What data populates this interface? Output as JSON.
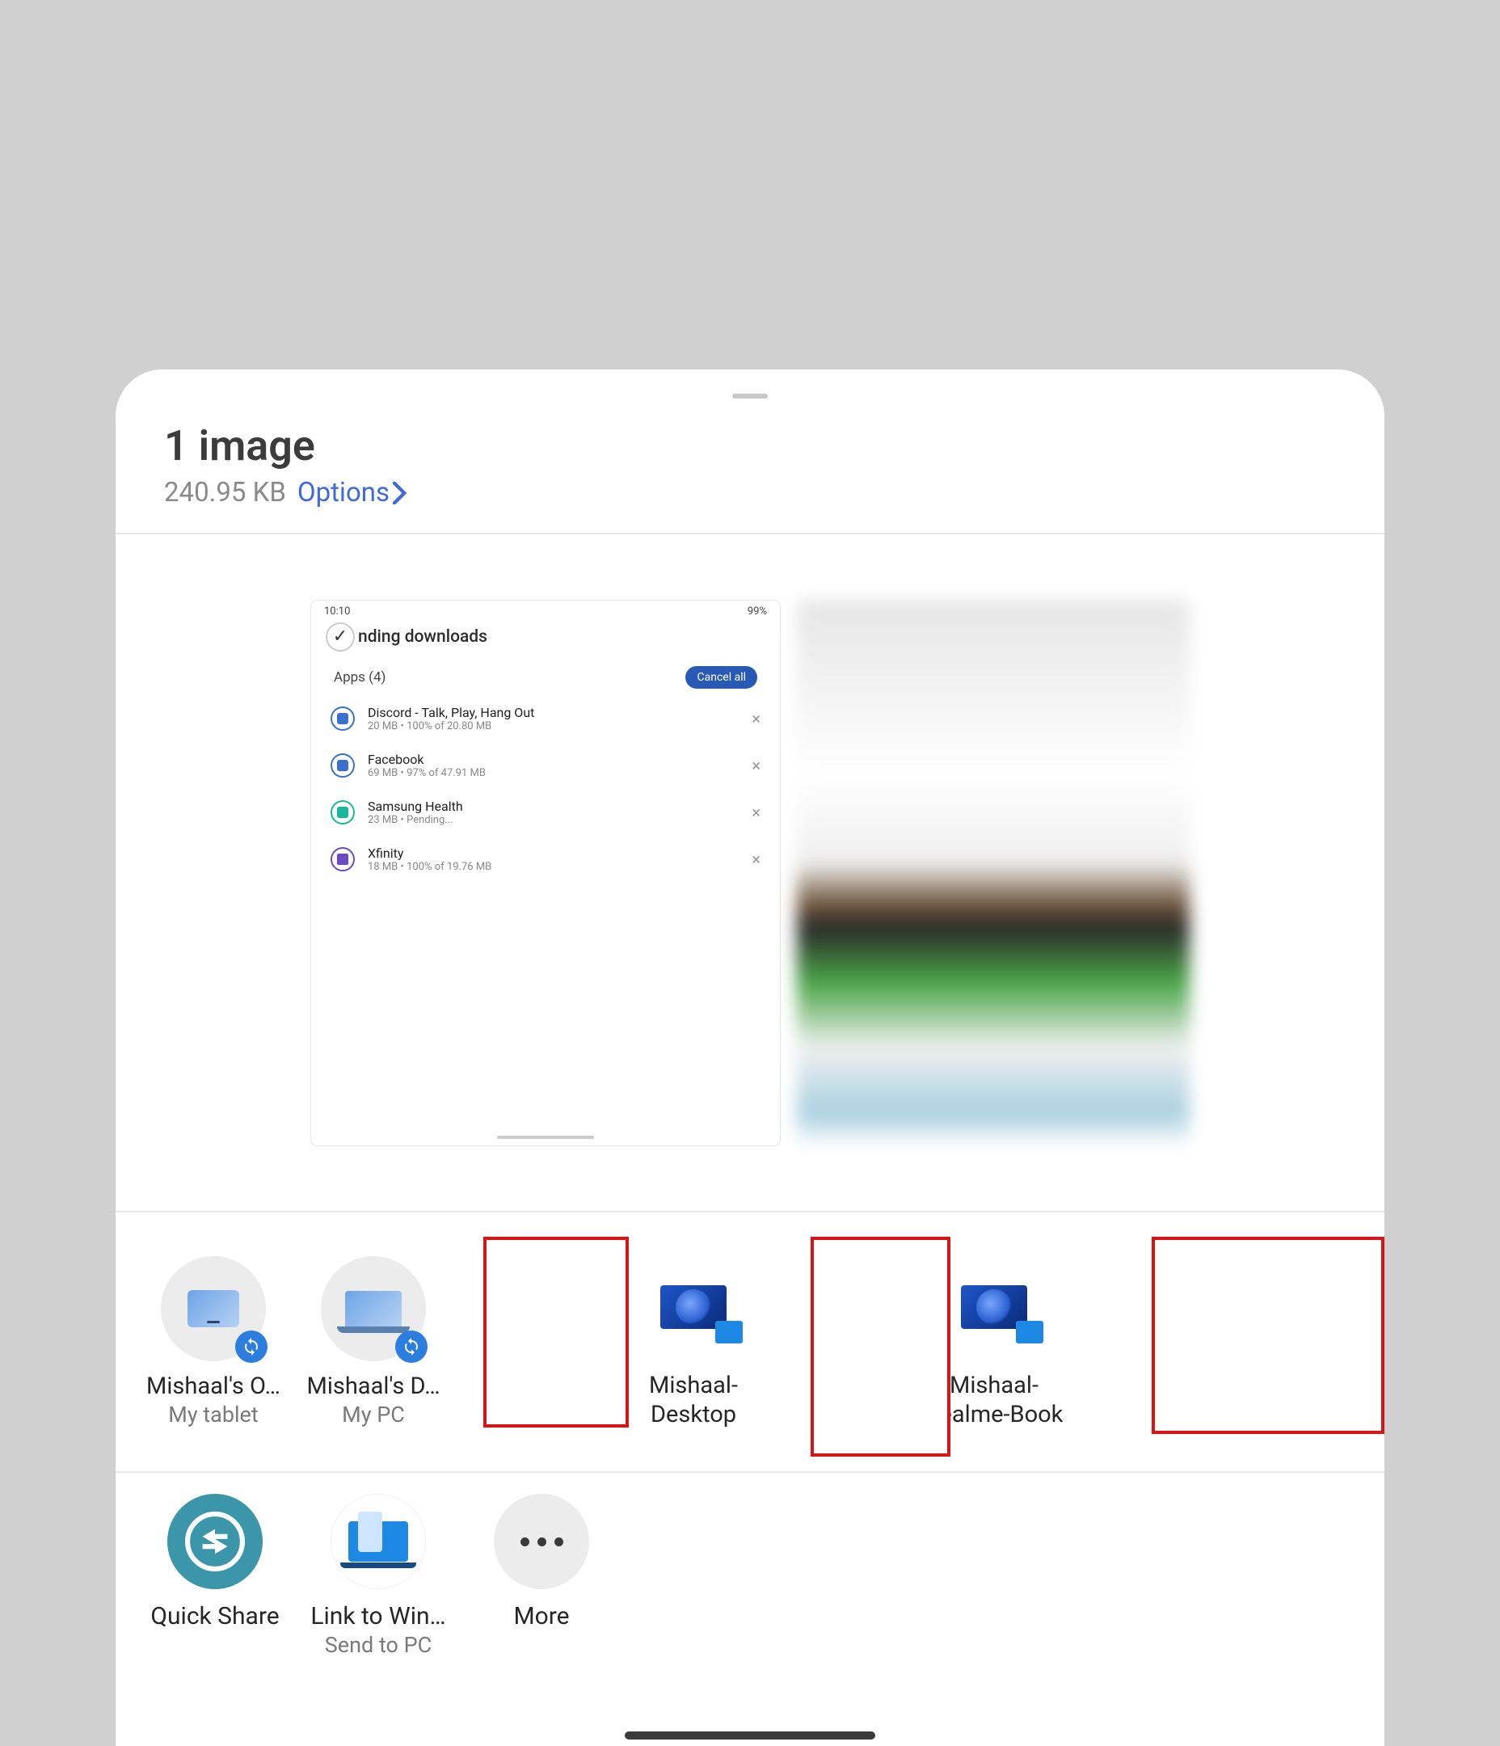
{
  "header": {
    "title": "1 image",
    "size": "240.95 KB",
    "options_label": "Options"
  },
  "screenshot_preview": {
    "status_time": "10:10",
    "status_right": "99%",
    "page_title": "nding downloads",
    "apps_label": "Apps (4)",
    "cancel_all": "Cancel all",
    "rows": [
      {
        "name": "Discord - Talk, Play, Hang Out",
        "sub": "20 MB  •  100% of 20.80 MB"
      },
      {
        "name": "Facebook",
        "sub": "69 MB  •  97% of 47.91 MB"
      },
      {
        "name": "Samsung Health",
        "sub": "23 MB  •  Pending..."
      },
      {
        "name": "Xfinity",
        "sub": "18 MB  •  100% of 19.76 MB"
      }
    ]
  },
  "devices": [
    {
      "label": "Mishaal's O…",
      "sub": "My tablet"
    },
    {
      "label": "Mishaal's D…",
      "sub": "My PC"
    },
    {
      "label_2line": "Mishaal-Desktop"
    },
    {
      "label_2line": "Mishaal-Realme-Book"
    }
  ],
  "actions": {
    "quick_share": "Quick Share",
    "link_to_windows": "Link to Win…",
    "link_to_windows_sub": "Send to PC",
    "more": "More"
  }
}
